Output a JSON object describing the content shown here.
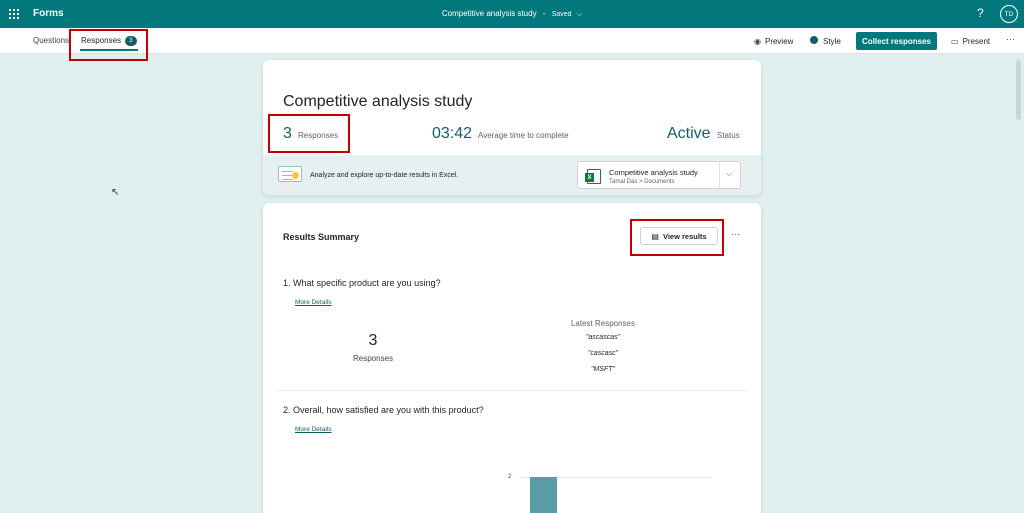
{
  "topbar": {
    "app_name": "Forms",
    "doc_title": "Competitive analysis study",
    "separator": "-",
    "saved": "Saved",
    "help": "?",
    "avatar": "TD"
  },
  "tabs": {
    "questions": "Questions",
    "responses": "Responses",
    "responses_count": "3"
  },
  "toolbar": {
    "preview": "Preview",
    "style": "Style",
    "collect": "Collect responses",
    "present": "Present",
    "more": "···"
  },
  "summary": {
    "title": "Competitive analysis study",
    "responses_count": "3",
    "responses_label": "Responses",
    "avg_time": "03:42",
    "avg_time_label": "Average time to complete",
    "status": "Active",
    "status_label": "Status"
  },
  "excel": {
    "text": "Analyze and explore up-to-date results in Excel.",
    "file_name": "Competitive analysis study",
    "file_path": "Tamal Das > Documents"
  },
  "results": {
    "title": "Results Summary",
    "view_results": "View results",
    "more": "···",
    "questions": [
      {
        "title": "1.  What specific product are you using?",
        "more_details": "More Details",
        "count": "3",
        "count_label": "Responses",
        "latest_title": "Latest Responses",
        "latest": [
          "\"ascascas\"",
          "\"cascasc\"",
          "\"MSFT\""
        ]
      },
      {
        "title": "2.  Overall, how satisfied are you with this product?",
        "more_details": "More Details"
      }
    ]
  },
  "chart_data": {
    "type": "bar",
    "y_tick_visible": "2",
    "values": [
      2
    ]
  },
  "colors": {
    "brand": "#03787c",
    "accent_dark": "#115e67",
    "highlight_box": "#c00000",
    "bar": "#5a9ca5"
  }
}
